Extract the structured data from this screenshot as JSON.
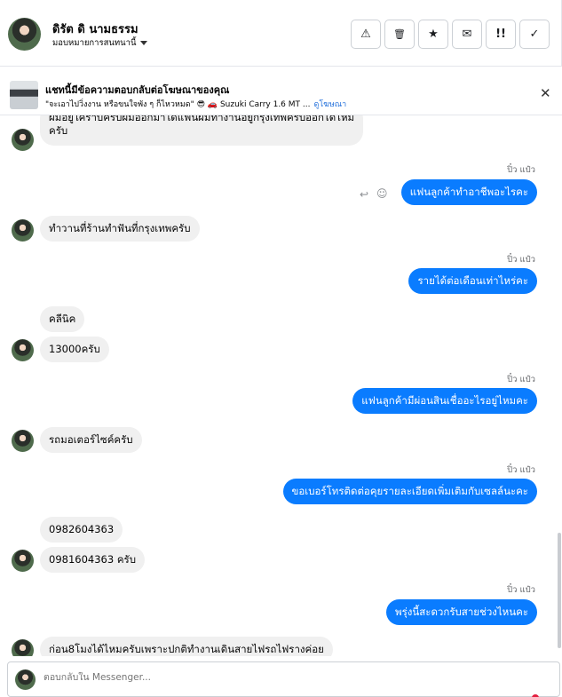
{
  "header": {
    "contact_name": "ดิรัต ดิ นามธรรม",
    "assign_label": "มอบหมายการสนทนานี้",
    "actions": [
      {
        "name": "report-spam-button",
        "icon": "⚠"
      },
      {
        "name": "delete-button",
        "icon": "🗑"
      },
      {
        "name": "star-button",
        "icon": "★"
      },
      {
        "name": "mark-unread-button",
        "icon": "✉"
      },
      {
        "name": "follow-up-button",
        "icon": "!!"
      },
      {
        "name": "mark-done-button",
        "icon": "✓"
      }
    ]
  },
  "ad_banner": {
    "title": "แชทนี้มีข้อความตอบกลับต่อโฆษณาของคุณ",
    "snippet": "\"จะเอาไปวิ่งงาน หรือขนใจพัง ๆ ก็ไหวหมด\" 😎 🚗 Suzuki Carry 1.6 MT ...",
    "link": "ดูโฆษณา",
    "close_icon": "✕"
  },
  "thread": {
    "sender_label": "ปิ๋ว แป๋ว",
    "messages": [
      {
        "side": "in",
        "text_1": "ผมอยู่ใครำบครับผมออกมาได้แฟนผมทำงานอยู่กรุงเทพครับออกได้ไหม",
        "text_2": "ครับ"
      },
      {
        "side": "out",
        "text": "แฟนลูกค้าทำอาชีพอะไรคะ"
      },
      {
        "side": "in",
        "text": "ทำวานที่ร้านทำฟันที่กรุงเทพครับ"
      },
      {
        "side": "out",
        "text": "รายได้ต่อเดือนเท่าไหร่คะ"
      },
      {
        "side": "in",
        "text": "คลีนิค"
      },
      {
        "side": "in",
        "text": "13000ครับ"
      },
      {
        "side": "out",
        "text": "แฟนลูกค้ามีผ่อนสินเชื่ออะไรอยู่ไหมคะ"
      },
      {
        "side": "in",
        "text": "รถมอเตอร์ไซค์ครับ"
      },
      {
        "side": "out",
        "text": "ขอเบอร์โทรติดต่อคุยรายละเอียดเพิ่มเติมกับเซลล์นะคะ"
      },
      {
        "side": "in",
        "text": "0982604363"
      },
      {
        "side": "in",
        "text": "0981604363 ครับ"
      },
      {
        "side": "out",
        "text": "พรุ่งนี้สะดวกรับสายช่วงไหนคะ"
      },
      {
        "side": "in",
        "text": "ก่อน8โมงได้ไหมครับเพราะปกติทำงานเดินสายไฟรถไฟรางค่อย"
      }
    ]
  },
  "composer": {
    "placeholder": "ตอบกลับใน Messenger..."
  },
  "colors": {
    "outgoing_bubble": "#0a7cff",
    "incoming_bubble": "#f0f0f0",
    "link": "#216fdb"
  }
}
